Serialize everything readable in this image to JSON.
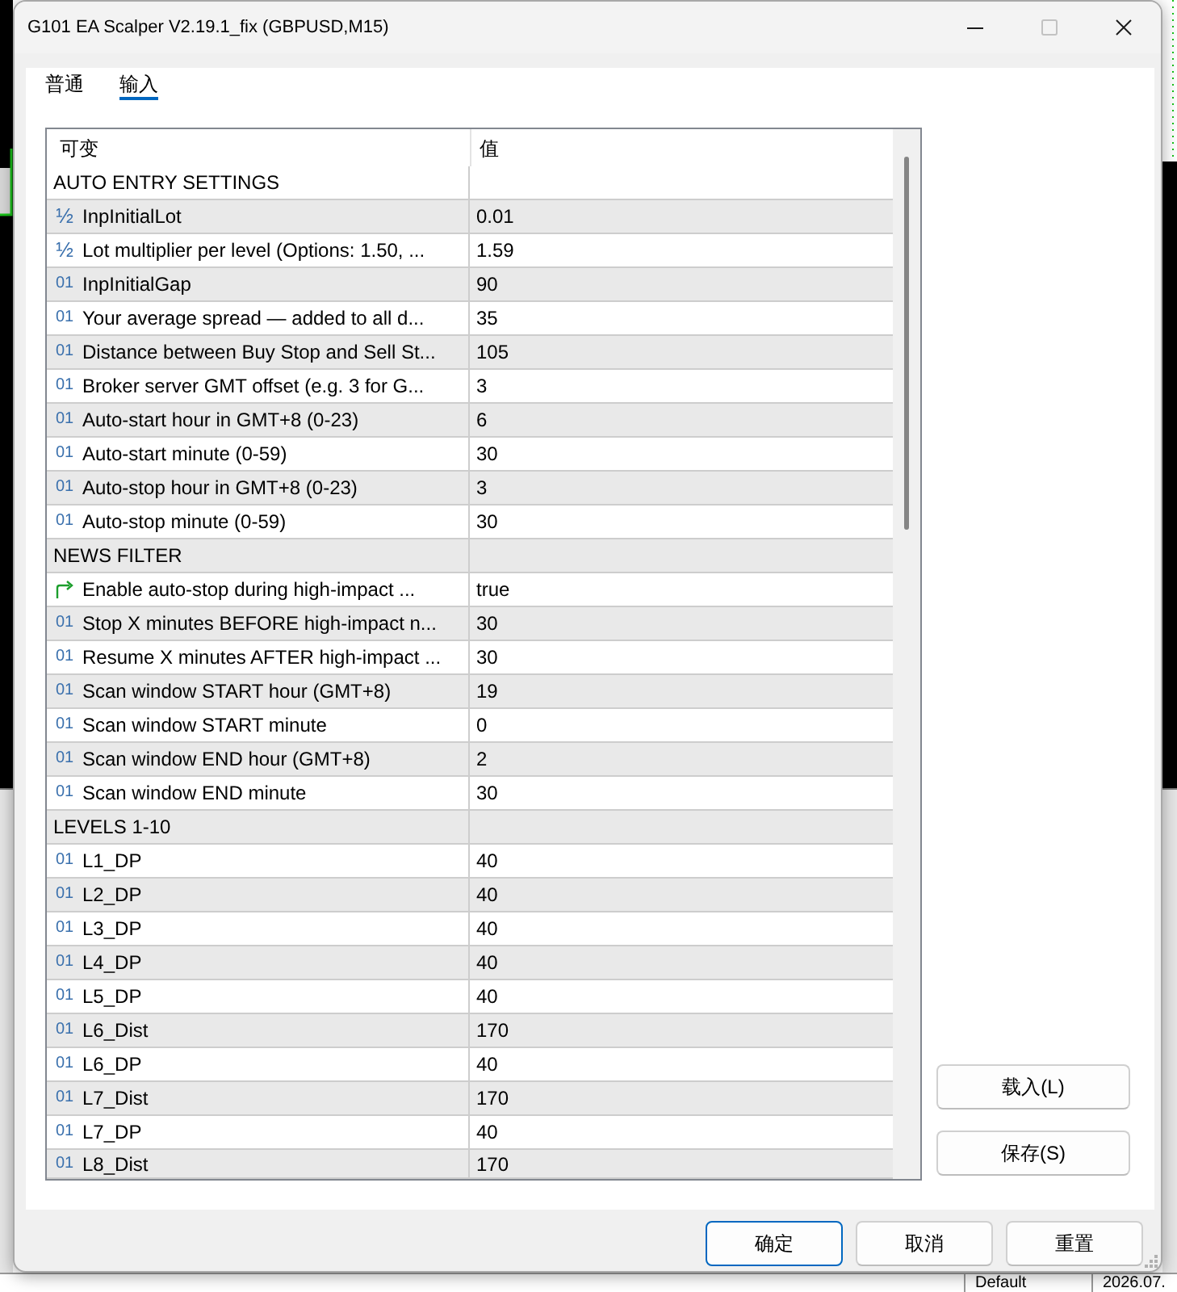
{
  "background": {
    "status_cells": [
      "Default",
      "2026.07."
    ]
  },
  "window": {
    "title": "G101 EA Scalper V2.19.1_fix (GBPUSD,M15)",
    "controls": [
      {
        "kind": "minimize",
        "disabled": false
      },
      {
        "kind": "maximize",
        "disabled": true
      },
      {
        "kind": "close",
        "disabled": false
      }
    ]
  },
  "tabs": [
    {
      "label": "普通",
      "selected": false
    },
    {
      "label": "输入",
      "selected": true
    }
  ],
  "table": {
    "columns": [
      "可变",
      "值"
    ],
    "rows": [
      {
        "kind": "group",
        "name": "AUTO ENTRY SETTINGS"
      },
      {
        "kind": "param",
        "icon": "½",
        "name": "InpInitialLot",
        "value": "0.01"
      },
      {
        "kind": "param",
        "icon": "½",
        "name": "Lot multiplier per level (Options: 1.50, ...",
        "value": "1.59"
      },
      {
        "kind": "param",
        "icon": "01",
        "name": "InpInitialGap",
        "value": "90"
      },
      {
        "kind": "param",
        "icon": "01",
        "name": "Your average spread — added to all d...",
        "value": "35"
      },
      {
        "kind": "param",
        "icon": "01",
        "name": "Distance between Buy Stop and Sell St...",
        "value": "105"
      },
      {
        "kind": "param",
        "icon": "01",
        "name": "Broker server GMT offset (e.g. 3 for G...",
        "value": "3"
      },
      {
        "kind": "param",
        "icon": "01",
        "name": "Auto-start hour in GMT+8 (0-23)",
        "value": "6"
      },
      {
        "kind": "param",
        "icon": "01",
        "name": "Auto-start minute (0-59)",
        "value": "30"
      },
      {
        "kind": "param",
        "icon": "01",
        "name": "Auto-stop hour in GMT+8 (0-23)",
        "value": "3"
      },
      {
        "kind": "param",
        "icon": "01",
        "name": "Auto-stop minute (0-59)",
        "value": "30"
      },
      {
        "kind": "group",
        "name": "NEWS FILTER"
      },
      {
        "kind": "bool",
        "name": "Enable auto-stop during high-impact ...",
        "value": "true"
      },
      {
        "kind": "param",
        "icon": "01",
        "name": "Stop X minutes BEFORE high-impact n...",
        "value": "30"
      },
      {
        "kind": "param",
        "icon": "01",
        "name": "Resume X minutes AFTER high-impact ...",
        "value": "30"
      },
      {
        "kind": "param",
        "icon": "01",
        "name": "Scan window START hour (GMT+8)",
        "value": "19"
      },
      {
        "kind": "param",
        "icon": "01",
        "name": "Scan window START minute",
        "value": "0"
      },
      {
        "kind": "param",
        "icon": "01",
        "name": "Scan window END hour (GMT+8)",
        "value": "2"
      },
      {
        "kind": "param",
        "icon": "01",
        "name": "Scan window END minute",
        "value": "30"
      },
      {
        "kind": "group",
        "name": "LEVELS 1-10"
      },
      {
        "kind": "param",
        "icon": "01",
        "name": "L1_DP",
        "value": "40"
      },
      {
        "kind": "param",
        "icon": "01",
        "name": "L2_DP",
        "value": "40"
      },
      {
        "kind": "param",
        "icon": "01",
        "name": "L3_DP",
        "value": "40"
      },
      {
        "kind": "param",
        "icon": "01",
        "name": "L4_DP",
        "value": "40"
      },
      {
        "kind": "param",
        "icon": "01",
        "name": "L5_DP",
        "value": "40"
      },
      {
        "kind": "param",
        "icon": "01",
        "name": "L6_Dist",
        "value": "170"
      },
      {
        "kind": "param",
        "icon": "01",
        "name": "L6_DP",
        "value": "40"
      },
      {
        "kind": "param",
        "icon": "01",
        "name": "L7_Dist",
        "value": "170"
      },
      {
        "kind": "param",
        "icon": "01",
        "name": "L7_DP",
        "value": "40"
      },
      {
        "kind": "param",
        "icon": "01",
        "name": "L8_Dist",
        "value": "170"
      }
    ]
  },
  "side_buttons": [
    "载入(L)",
    "保存(S)"
  ],
  "buttons": [
    {
      "label": "确定",
      "default": true
    },
    {
      "label": "取消",
      "default": false
    },
    {
      "label": "重置",
      "default": false
    }
  ]
}
